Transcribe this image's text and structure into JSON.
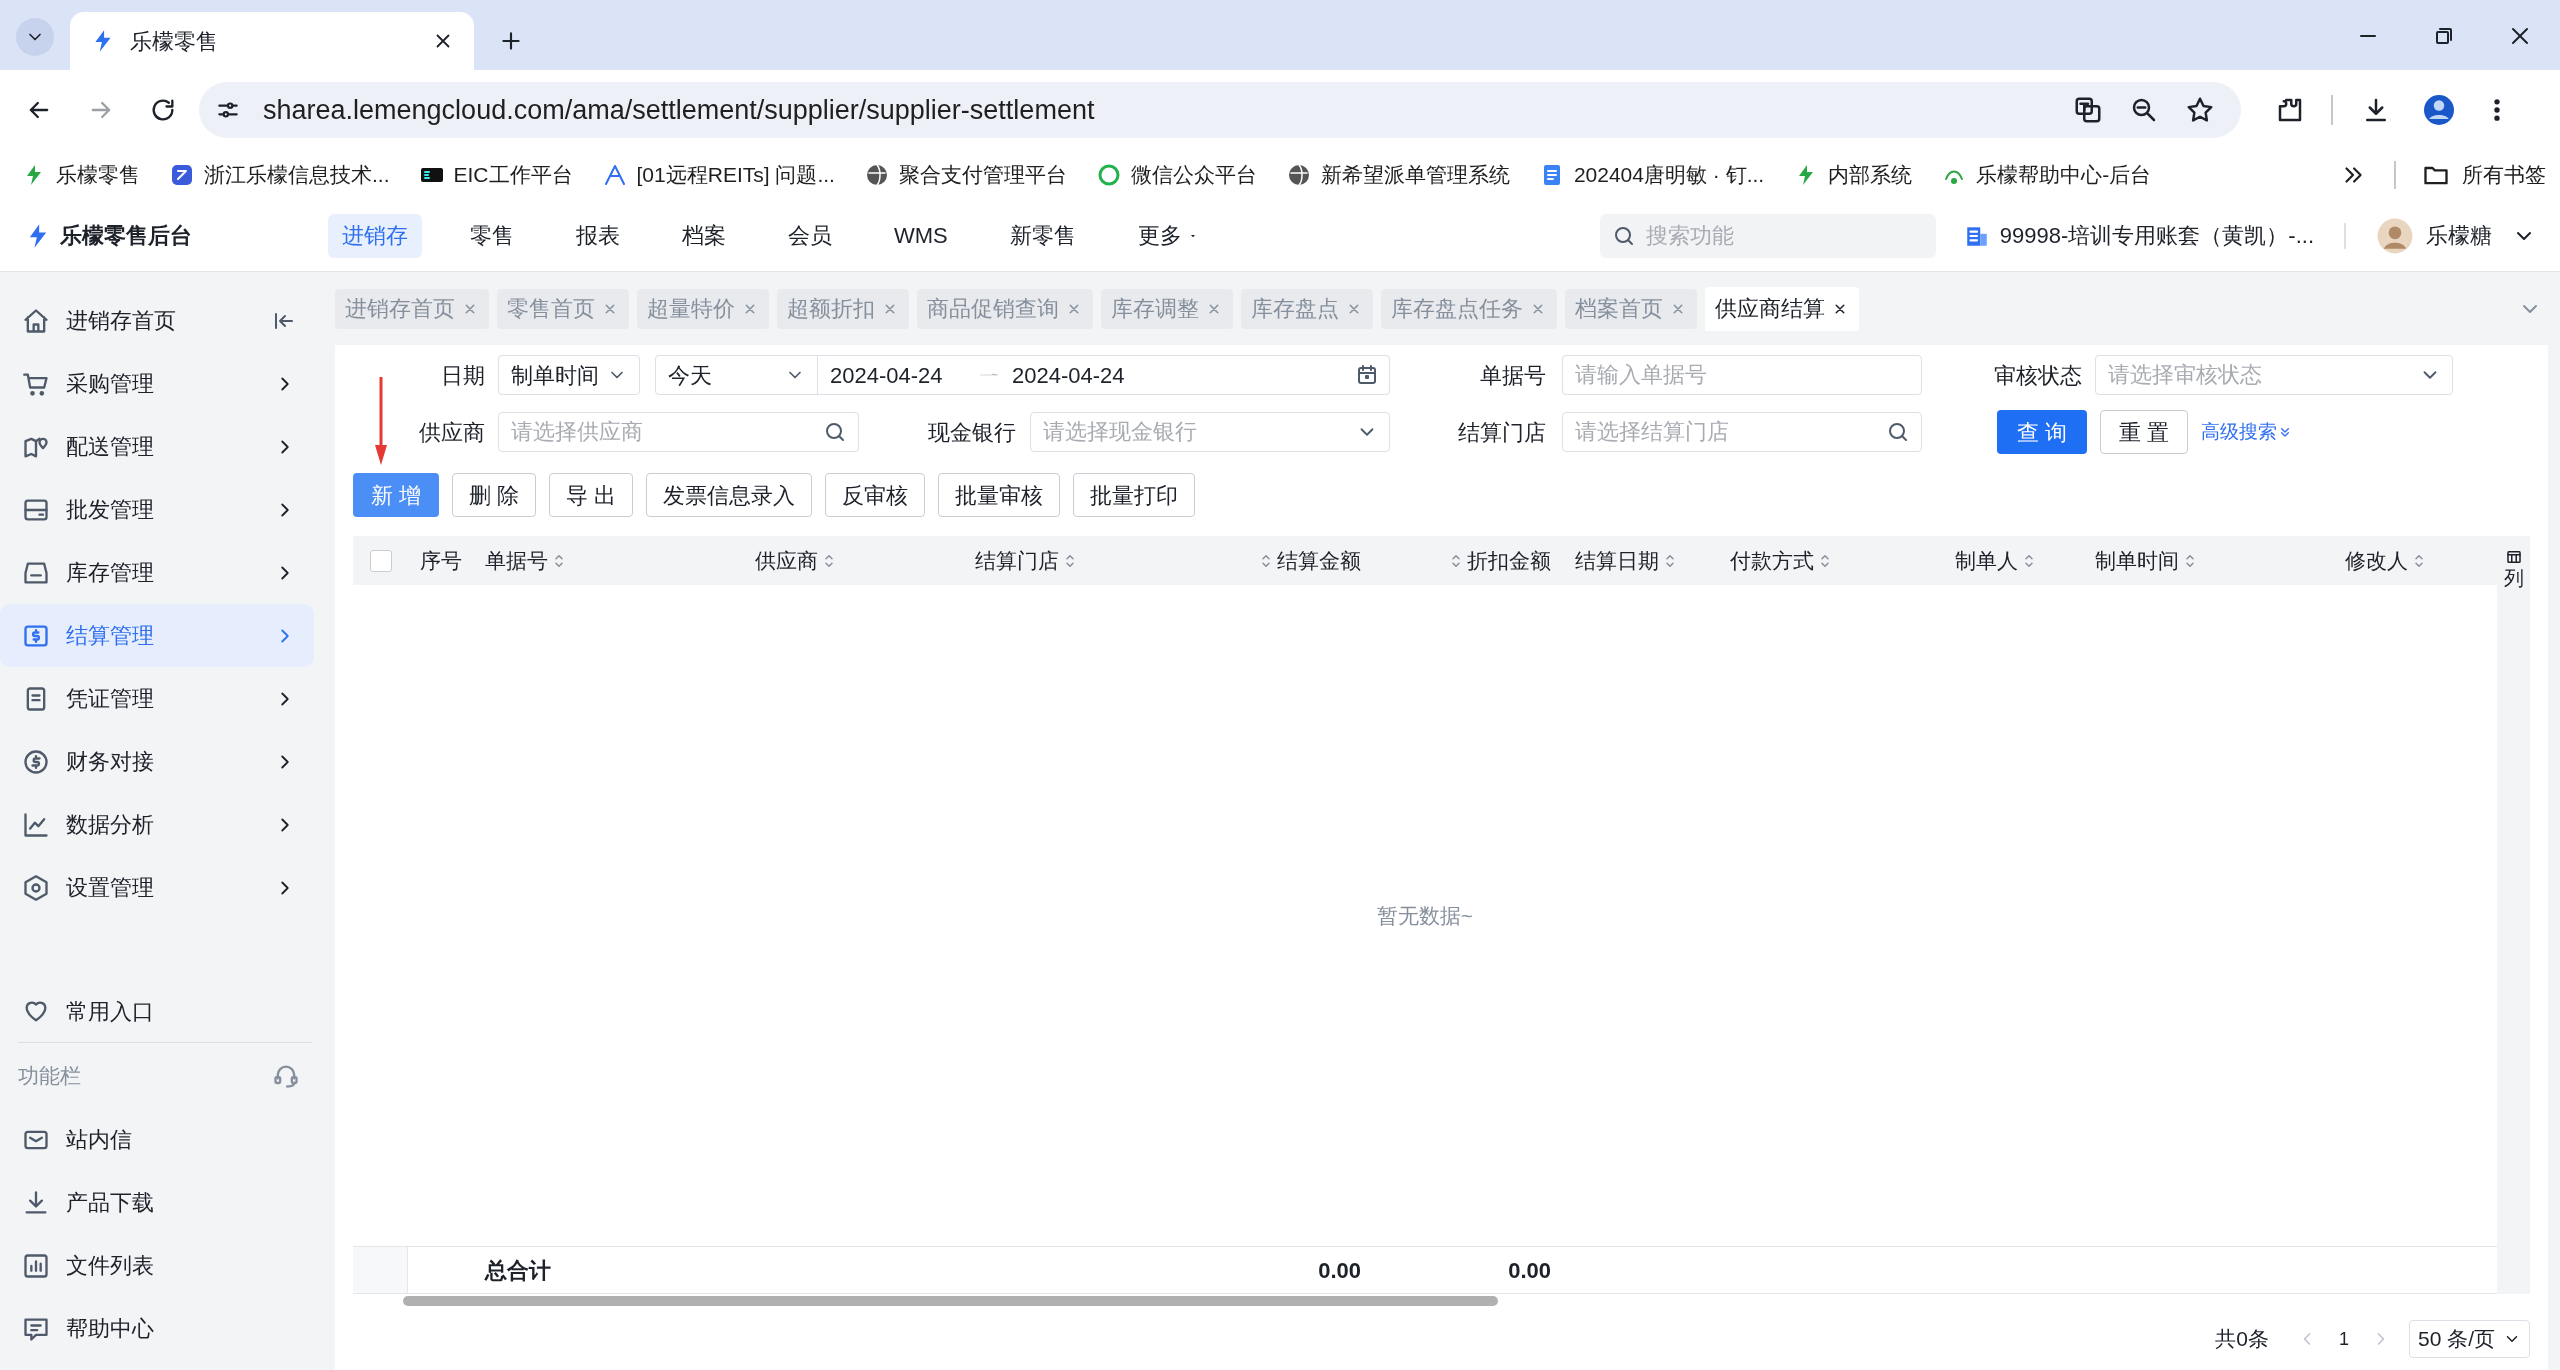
{
  "browser": {
    "tabs": [
      {
        "title": "乐檬零售",
        "selected": true
      }
    ],
    "url": "sharea.lemengcloud.com/ama/settlement/supplier/supplier-settlement",
    "bookmarks": [
      {
        "label": "乐檬零售"
      },
      {
        "label": "浙江乐檬信息技术..."
      },
      {
        "label": "EIC工作平台"
      },
      {
        "label": "[01远程REITs] 问题..."
      },
      {
        "label": "聚合支付管理平台"
      },
      {
        "label": "微信公众平台"
      },
      {
        "label": "新希望派单管理系统"
      },
      {
        "label": "202404唐明敏 · 钉..."
      },
      {
        "label": "内部系统"
      },
      {
        "label": "乐檬帮助中心-后台"
      }
    ],
    "all_bookmarks": "所有书签"
  },
  "app": {
    "logo": "乐檬零售后台",
    "nav": [
      {
        "label": "进销存",
        "selected": true,
        "dropdown": false
      },
      {
        "label": "零售",
        "selected": false,
        "dropdown": false
      },
      {
        "label": "报表",
        "selected": false,
        "dropdown": false
      },
      {
        "label": "档案",
        "selected": false,
        "dropdown": false
      },
      {
        "label": "会员",
        "selected": false,
        "dropdown": false
      },
      {
        "label": "WMS",
        "selected": false,
        "dropdown": false
      },
      {
        "label": "新零售",
        "selected": false,
        "dropdown": false
      },
      {
        "label": "更多",
        "selected": false,
        "dropdown": true
      }
    ],
    "search_placeholder": "搜索功能",
    "account": "99998-培训专用账套（黄凯）-...",
    "user": "乐檬糖"
  },
  "sidebar": {
    "items": [
      {
        "label": "进销存首页",
        "kind": "link",
        "selected": false
      },
      {
        "label": "采购管理",
        "kind": "group",
        "selected": false
      },
      {
        "label": "配送管理",
        "kind": "group",
        "selected": false
      },
      {
        "label": "批发管理",
        "kind": "group",
        "selected": false
      },
      {
        "label": "库存管理",
        "kind": "group",
        "selected": false
      },
      {
        "label": "结算管理",
        "kind": "group",
        "selected": true
      },
      {
        "label": "凭证管理",
        "kind": "group",
        "selected": false
      },
      {
        "label": "财务对接",
        "kind": "group",
        "selected": false
      },
      {
        "label": "数据分析",
        "kind": "group",
        "selected": false
      },
      {
        "label": "设置管理",
        "kind": "group",
        "selected": false
      }
    ],
    "favorites": "常用入口",
    "section": "功能栏",
    "tools": [
      {
        "label": "站内信"
      },
      {
        "label": "产品下载"
      },
      {
        "label": "文件列表"
      },
      {
        "label": "帮助中心"
      }
    ]
  },
  "page_tabs": [
    {
      "label": "进销存首页",
      "selected": false
    },
    {
      "label": "零售首页",
      "selected": false
    },
    {
      "label": "超量特价",
      "selected": false
    },
    {
      "label": "超额折扣",
      "selected": false
    },
    {
      "label": "商品促销查询",
      "selected": false
    },
    {
      "label": "库存调整",
      "selected": false
    },
    {
      "label": "库存盘点",
      "selected": false
    },
    {
      "label": "库存盘点任务",
      "selected": false
    },
    {
      "label": "档案首页",
      "selected": false
    },
    {
      "label": "供应商结算",
      "selected": true
    }
  ],
  "filters": [
    {
      "kind": "date",
      "label": "日期",
      "type": "制单时间",
      "preset": "今天",
      "start": "2024-04-24",
      "end": "2024-04-24"
    },
    {
      "kind": "input",
      "label": "单据号",
      "placeholder": "请输入单据号"
    },
    {
      "kind": "select",
      "label": "审核状态",
      "placeholder": "请选择审核状态"
    },
    {
      "kind": "search",
      "label": "供应商",
      "placeholder": "请选择供应商"
    },
    {
      "kind": "select",
      "label": "现金银行",
      "placeholder": "请选择现金银行"
    },
    {
      "kind": "search",
      "label": "结算门店",
      "placeholder": "请选择结算门店"
    }
  ],
  "query_buttons": [
    {
      "label": "查 询",
      "primary": true
    },
    {
      "label": "重 置",
      "primary": false
    }
  ],
  "advanced_search": "高级搜索",
  "actions": [
    {
      "label": "新 增",
      "primary": true
    },
    {
      "label": "删 除",
      "primary": false
    },
    {
      "label": "导 出",
      "primary": false
    },
    {
      "label": "发票信息录入",
      "primary": false
    },
    {
      "label": "反审核",
      "primary": false
    },
    {
      "label": "批量审核",
      "primary": false
    },
    {
      "label": "批量打印",
      "primary": false
    }
  ],
  "table": {
    "select_all_checked": false,
    "columns": [
      {
        "label": "序号",
        "sortable": false,
        "kind": "text"
      },
      {
        "label": "单据号",
        "sortable": true,
        "kind": "text"
      },
      {
        "label": "供应商",
        "sortable": true,
        "kind": "text"
      },
      {
        "label": "结算门店",
        "sortable": true,
        "kind": "text"
      },
      {
        "label": "结算金额",
        "sortable": true,
        "kind": "amount"
      },
      {
        "label": "折扣金额",
        "sortable": true,
        "kind": "amount"
      },
      {
        "label": "结算日期",
        "sortable": true,
        "kind": "text"
      },
      {
        "label": "付款方式",
        "sortable": true,
        "kind": "text"
      },
      {
        "label": "制单人",
        "sortable": true,
        "kind": "text"
      },
      {
        "label": "制单时间",
        "sortable": true,
        "kind": "text"
      },
      {
        "label": "修改人",
        "sortable": true,
        "kind": "text"
      }
    ],
    "empty_text": "暂无数据~",
    "totals": {
      "label": "总合计",
      "settlement_amount": "0.00",
      "discount_amount": "0.00"
    },
    "column_settings": "列"
  },
  "pagination": {
    "total": "共0条",
    "page": "1",
    "page_size": "50 条/页"
  }
}
